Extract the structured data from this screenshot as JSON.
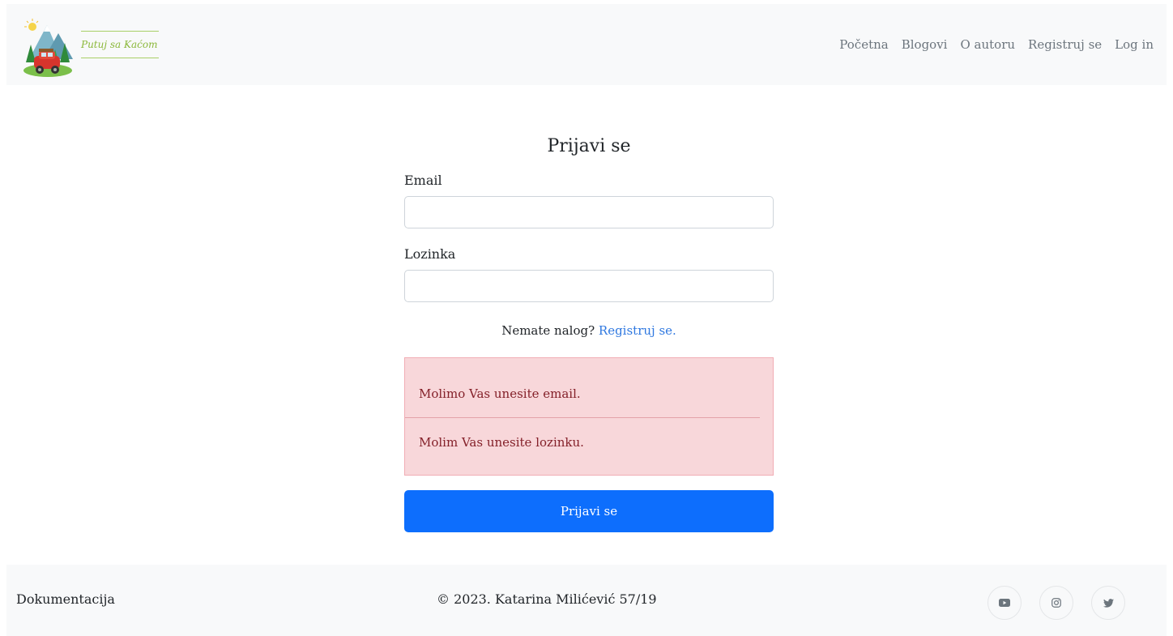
{
  "brand": {
    "name": "Putuj sa Kaćom"
  },
  "nav": {
    "items": [
      {
        "label": "Početna"
      },
      {
        "label": "Blogovi"
      },
      {
        "label": "O autoru"
      },
      {
        "label": "Registruj se"
      },
      {
        "label": "Log in"
      }
    ]
  },
  "form": {
    "title": "Prijavi se",
    "email_label": "Email",
    "email_value": "",
    "password_label": "Lozinka",
    "password_value": "",
    "register_prompt": "Nemate nalog?",
    "register_link": "Registruj se.",
    "errors": [
      "Molimo Vas unesite email.",
      "Molim Vas unesite lozinku."
    ],
    "submit_label": "Prijavi se"
  },
  "footer": {
    "doc_link": "Dokumentacija",
    "copyright": "© 2023. Katarina Milićević 57/19",
    "socials": [
      {
        "icon": "youtube-icon"
      },
      {
        "icon": "instagram-icon"
      },
      {
        "icon": "twitter-icon"
      }
    ]
  },
  "colors": {
    "primary": "#0d6efd",
    "alert_bg": "#f8d7da",
    "alert_text": "#842029",
    "link": "#2f78e0",
    "brand": "#8bb83a"
  }
}
